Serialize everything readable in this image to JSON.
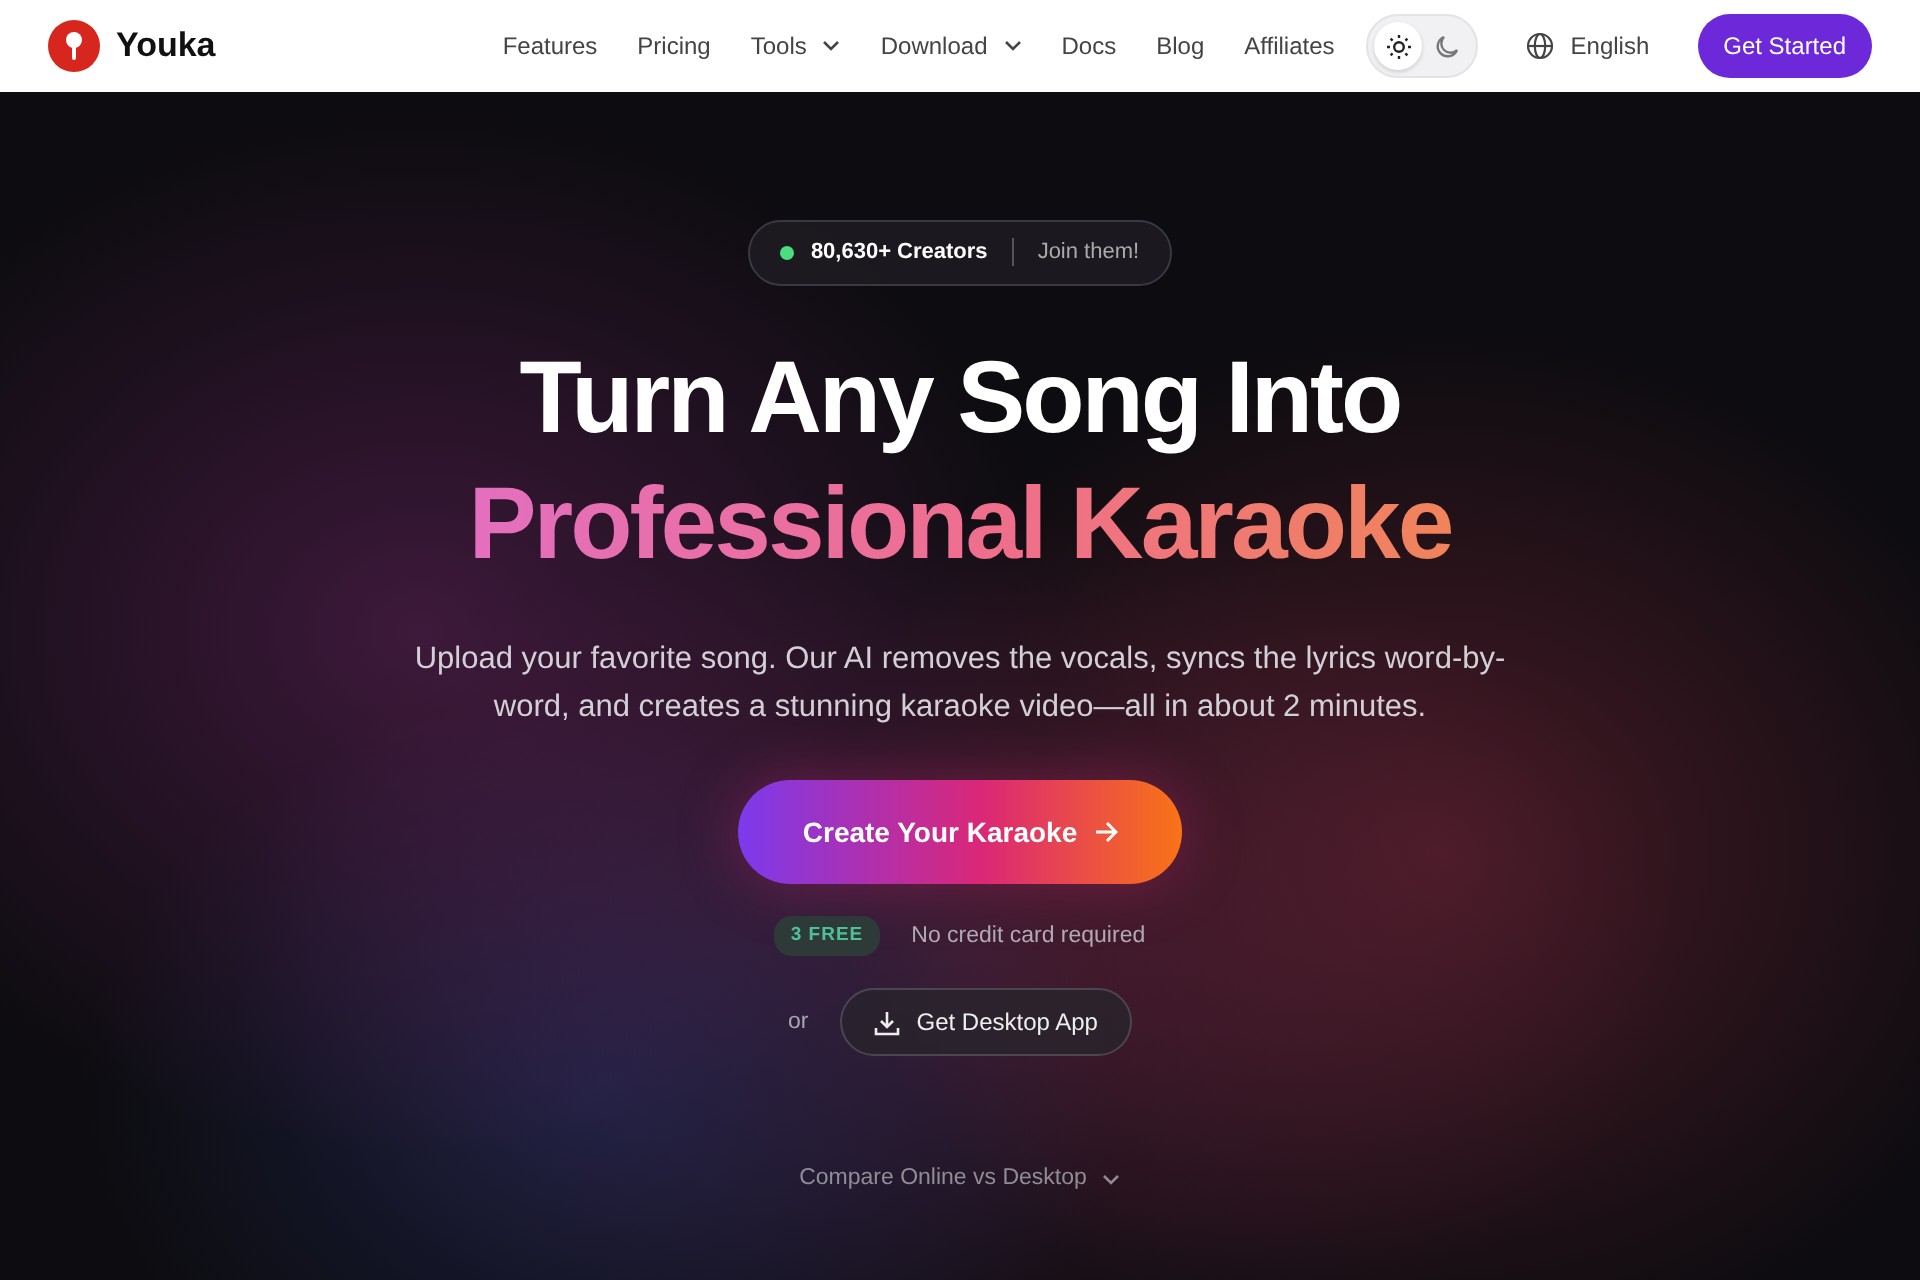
{
  "brand": {
    "name": "Youka"
  },
  "nav": [
    {
      "label": "Features",
      "kind": "link"
    },
    {
      "label": "Pricing",
      "kind": "link"
    },
    {
      "label": "Tools",
      "kind": "dropdown"
    },
    {
      "label": "Download",
      "kind": "dropdown"
    },
    {
      "label": "Docs",
      "kind": "link"
    },
    {
      "label": "Blog",
      "kind": "link"
    },
    {
      "label": "Affiliates",
      "kind": "link"
    }
  ],
  "theme_toggle": [
    {
      "kind": "light",
      "selected": true
    },
    {
      "kind": "dark",
      "selected": false
    }
  ],
  "language": "English",
  "cta": "Get Started",
  "hero": {
    "badge": {
      "count": "80,630+ Creators",
      "link": "Join them!",
      "color": "#4ade80"
    },
    "title": "Turn Any Song Into",
    "title_highlight": "Professional Karaoke",
    "subtitle": "Upload your favorite song. Our AI removes the vocals, syncs the lyrics word-by-word, and creates a stunning karaoke video—all in about 2 minutes.",
    "primary_button": "Create Your Karaoke",
    "free_tag": "3 FREE",
    "free_note": "No credit card required",
    "or": "or",
    "secondary_button": "Get Desktop App",
    "compare": "Compare Online vs Desktop"
  }
}
